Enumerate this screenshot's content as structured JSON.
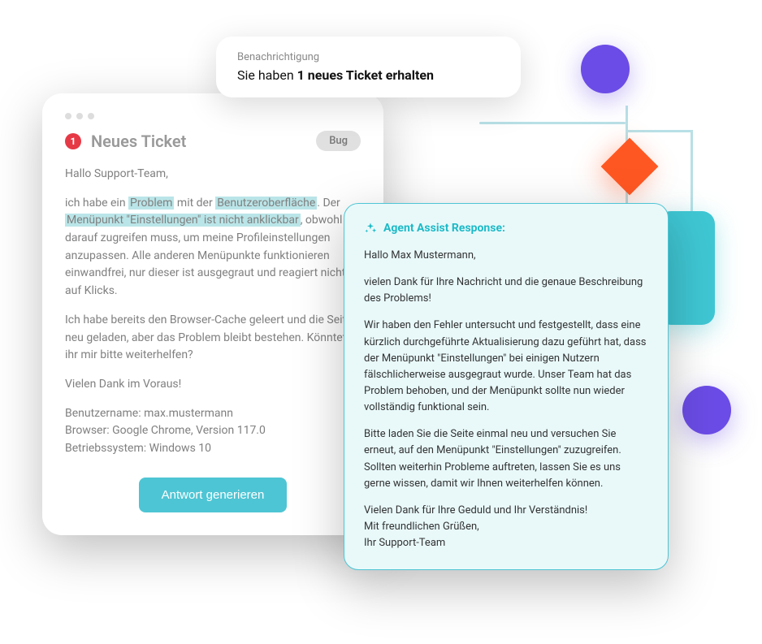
{
  "notification": {
    "label": "Benachrichtigung",
    "text_prefix": "Sie haben ",
    "text_strong": "1 neues Ticket erhalten"
  },
  "ticket": {
    "badge_count": "1",
    "title": "Neues Ticket",
    "tag": "Bug",
    "greeting": "Hallo Support-Team,",
    "body_p1_a": "ich habe ein ",
    "body_p1_hl1": "Problem",
    "body_p1_b": " mit der ",
    "body_p1_hl2": "Benutzeroberfläche",
    "body_p1_c": ". Der ",
    "body_p1_hl3": "Menüpunkt \"Einstellungen\" ist nicht anklickbar",
    "body_p1_d": ", obwohl ich darauf zugreifen muss, um meine Profileinstellungen anzupassen. Alle anderen Menüpunkte funktionieren einwandfrei, nur dieser ist ausgegraut und reagiert nicht auf Klicks.",
    "body_p2": "Ich habe bereits den Browser-Cache geleert und die Seite neu geladen, aber das Problem bleibt bestehen. Könntet ihr mir bitte weiterhelfen?",
    "body_p3": "Vielen Dank im Voraus!",
    "username_label": "Benutzername: max.mustermann",
    "browser_label": "Browser: Google Chrome, Version 117.0",
    "os_label": "Betriebssystem: Windows 10",
    "button": "Antwort generieren"
  },
  "assist": {
    "title": "Agent Assist Response:",
    "greeting": "Hallo Max Mustermann,",
    "p1": "vielen Dank für Ihre Nachricht und die genaue Beschreibung des Problems!",
    "p2": "Wir haben den Fehler untersucht und festgestellt, dass eine kürzlich durchgeführte Aktualisierung dazu geführt hat, dass der Menüpunkt \"Einstellungen\" bei einigen Nutzern fälschlicherweise ausgegraut wurde. Unser Team hat das Problem behoben, und der Menüpunkt sollte nun wieder vollständig funktional sein.",
    "p3": "Bitte laden Sie die Seite einmal neu und versuchen Sie erneut, auf den Menüpunkt \"Einstellungen\" zuzugreifen. Sollten weiterhin Probleme auftreten, lassen Sie es uns gerne wissen, damit wir Ihnen weiterhelfen können.",
    "p4": "Vielen Dank für Ihre Geduld und Ihr Verständnis!",
    "p5": "Mit freundlichen Grüßen,",
    "p6": "Ihr Support-Team"
  }
}
